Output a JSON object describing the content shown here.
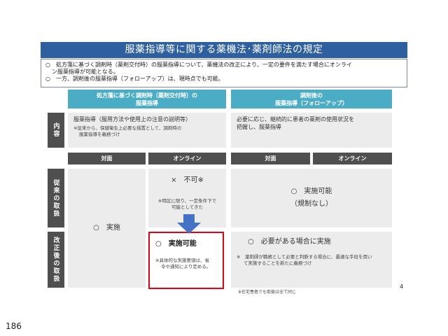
{
  "title": "服薬指導等に関する薬機法･薬剤師法の規定",
  "intro": {
    "line1": "○　処方箋に基づく調剤時（薬剤交付時）の服薬指導について、薬機法の改正により、一定の要件を満たす場合にオンライ",
    "line2": "ン服薬指導が可能となる。",
    "line3": "○　一方、調剤後の服薬指導（フォローアップ）は、現時点でも可能。"
  },
  "columns": {
    "left_line1": "処方箋に基づく調剤時（薬剤交付時）の",
    "left_line2": "服薬指導",
    "right_line1": "調剤後の",
    "right_line2": "服薬指導（フォローアップ）"
  },
  "content_row": {
    "label": "内容",
    "left_main": "服薬指導（服用方法や使用上の注意の説明等）",
    "left_note_1": "※従来から、保健衛生上必要な措置として、調剤時の",
    "left_note_2": "服薬指導を義務づけ",
    "right_main_1": "必要に応じ、継続的に患者の薬剤の使用状況を",
    "right_main_2": "把握し、服薬指導"
  },
  "sub_headers": {
    "left_face": "対面",
    "left_online": "オンライン",
    "right_face": "対面",
    "right_online": "オンライン"
  },
  "previous_row": {
    "label": "従来の取扱",
    "online_main": "×　不可※",
    "online_note_1": "※特区に限り、一定条件下で",
    "online_note_2": "可能としてきた",
    "right_main_1": "○　実施可能",
    "right_main_2": "（規制なし）"
  },
  "face_shared": "○　実施",
  "revised_row": {
    "label": "改正後の取扱",
    "online_main": "○　実施可能",
    "online_note_1": "※具体的な実施要領は、省",
    "online_note_2": "令や通知により定める。",
    "right_main": "○　必要がある場合に実施",
    "right_note_1": "※　薬剤師が職務として必要と判断する場合に、最適な手段を用い",
    "right_note_2": "て実施することを新たに義務づけ"
  },
  "footnote": "※在宅患者でも取扱は全て同じ",
  "page_number": "4",
  "bottom_number": "186",
  "colors": {
    "title_bg": "#2e5f9e",
    "column_head_bg": "#4bacc6",
    "row_head_bg": "#4f4f4f",
    "highlight_border": "#e60012",
    "arrow": "#4472c4"
  }
}
